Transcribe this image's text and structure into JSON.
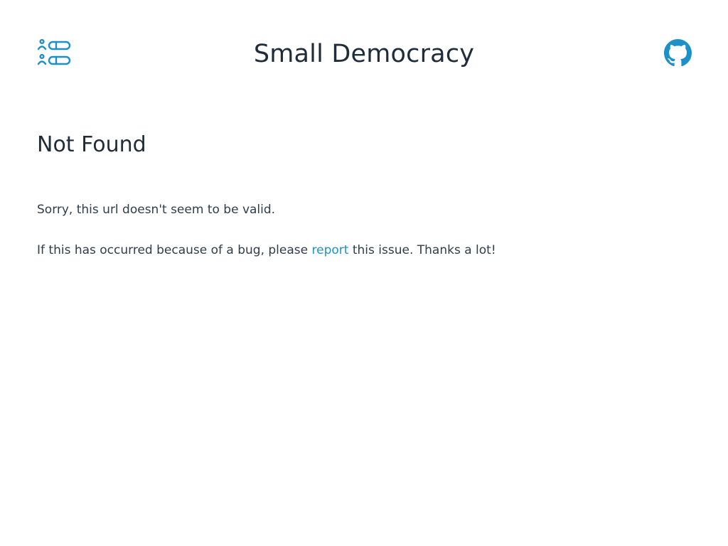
{
  "header": {
    "logo_icon": "ballot-list-icon",
    "title": "Small Democracy",
    "github_icon": "github-icon"
  },
  "main": {
    "heading": "Not Found",
    "message": "Sorry, this url doesn't seem to be valid.",
    "bug_prefix": "If this has occurred because of a bug, please",
    "report_link": "report",
    "bug_suffix": "this issue. Thanks a lot!"
  },
  "colors": {
    "accent": "#1e90c8",
    "text": "#1f2d3a"
  }
}
